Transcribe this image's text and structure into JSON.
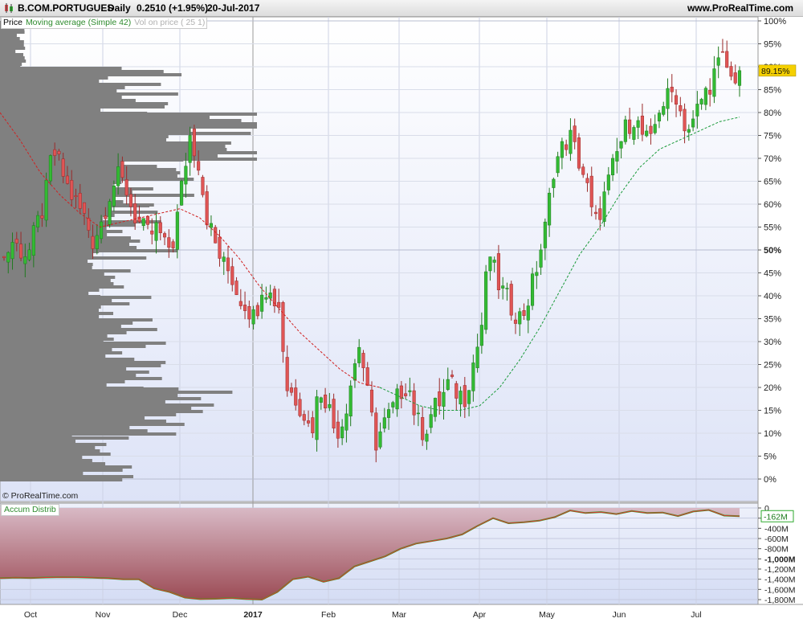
{
  "header": {
    "symbol": "B.COM.PORTUGUES",
    "period": "Daily",
    "quote": "0.2510 (+1.95%)",
    "date": "20-Jul-2017",
    "brand": "www.ProRealTime.com"
  },
  "legend": {
    "price": "Price",
    "ma": "Moving average (Simple 42)",
    "vol": "Vol on price ( 25 1)"
  },
  "copyright": "© ProRealTime.com",
  "indicator": {
    "title": "Accum Distrib"
  },
  "colors": {
    "up": "#33bb33",
    "down": "#e05555",
    "ma": "#1a9a3a",
    "ma_red": "#d02020",
    "volume": "#808080",
    "last_badge": "#f5d000"
  },
  "chart_data": [
    {
      "type": "candlestick",
      "title": "",
      "x_axis_labels": [
        "Oct",
        "Nov",
        "Dec",
        "2017",
        "Feb",
        "Mar",
        "Apr",
        "May",
        "Jun",
        "Jul"
      ],
      "y_ticks": [
        "0%",
        "5%",
        "10%",
        "15%",
        "20%",
        "25%",
        "30%",
        "35%",
        "40%",
        "45%",
        "50%",
        "55%",
        "60%",
        "65%",
        "70%",
        "75%",
        "80%",
        "85%",
        "90%",
        "95%",
        "100%"
      ],
      "ylim": [
        0,
        100
      ],
      "last_value_label": "89.15%",
      "last_value": 89.15,
      "close_path": [
        48,
        52,
        50,
        49,
        55,
        60,
        72,
        68,
        63,
        60,
        57,
        52,
        56,
        62,
        66,
        64,
        58,
        55,
        53,
        55,
        50,
        52,
        64,
        75,
        70,
        58,
        52,
        47,
        45,
        40,
        38,
        35,
        43,
        40,
        38,
        20,
        18,
        15,
        10,
        20,
        17,
        10,
        13,
        22,
        30,
        18,
        8,
        12,
        15,
        19,
        21,
        13,
        10,
        15,
        17,
        21,
        19,
        18,
        25,
        32,
        50,
        43,
        40,
        37,
        35,
        40,
        47,
        55,
        68,
        72,
        75,
        70,
        65,
        55,
        60,
        66,
        72,
        77,
        79,
        75,
        73,
        81,
        83,
        85,
        78,
        76,
        82,
        85,
        89,
        92,
        87,
        89.15
      ],
      "ma42_path": [
        80,
        74,
        67,
        62,
        58,
        55,
        56,
        57,
        58,
        59,
        57,
        53,
        48,
        42,
        37,
        32,
        28,
        24,
        21,
        20,
        18,
        16,
        15,
        15,
        16,
        20,
        26,
        33,
        41,
        49,
        55,
        62,
        68,
        72,
        74,
        76,
        78,
        79
      ],
      "ma42_red_until_index": 19,
      "volume_profile": [
        {
          "from_pct": 0,
          "to_pct": 10,
          "level": 0.4
        },
        {
          "from_pct": 10,
          "to_pct": 20,
          "level": 0.72
        },
        {
          "from_pct": 20,
          "to_pct": 30,
          "level": 0.5
        },
        {
          "from_pct": 30,
          "to_pct": 40,
          "level": 0.5
        },
        {
          "from_pct": 40,
          "to_pct": 50,
          "level": 0.48
        },
        {
          "from_pct": 50,
          "to_pct": 60,
          "level": 0.55
        },
        {
          "from_pct": 60,
          "to_pct": 70,
          "level": 0.6
        },
        {
          "from_pct": 70,
          "to_pct": 80,
          "level": 0.9
        },
        {
          "from_pct": 80,
          "to_pct": 90,
          "level": 0.55
        },
        {
          "from_pct": 90,
          "to_pct": 100,
          "level": 0.08
        }
      ]
    },
    {
      "type": "area",
      "title": "Accum Distrib",
      "y_ticks": [
        "0",
        "-200M",
        "-400M",
        "-600M",
        "-800M",
        "-1,000M",
        "-1,200M",
        "-1,400M",
        "-1,600M",
        "-1,800M"
      ],
      "ylim": [
        -1800,
        0
      ],
      "unit": "M",
      "last_value_label": "-162M",
      "last_value": -162,
      "path": [
        -1380,
        -1370,
        -1375,
        -1365,
        -1360,
        -1362,
        -1370,
        -1380,
        -1400,
        -1400,
        -1580,
        -1650,
        -1760,
        -1790,
        -1785,
        -1770,
        -1790,
        -1800,
        -1650,
        -1400,
        -1350,
        -1450,
        -1380,
        -1150,
        -1050,
        -950,
        -800,
        -700,
        -650,
        -600,
        -520,
        -350,
        -200,
        -300,
        -280,
        -250,
        -180,
        -50,
        -100,
        -80,
        -120,
        -60,
        -100,
        -90,
        -160,
        -70,
        -40,
        -150,
        -162
      ]
    }
  ]
}
